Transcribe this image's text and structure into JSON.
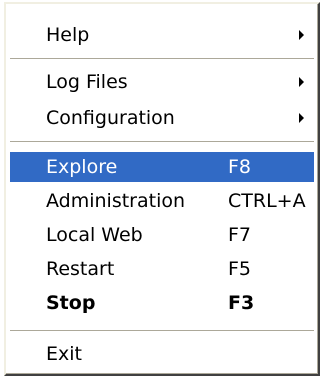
{
  "menu": {
    "items": [
      {
        "label": "Help",
        "submenu": true
      },
      {
        "label": "Log Files",
        "submenu": true
      },
      {
        "label": "Configuration",
        "submenu": true
      },
      {
        "label": "Explore",
        "shortcut": "F8",
        "selected": true
      },
      {
        "label": "Administration",
        "shortcut": "CTRL+A"
      },
      {
        "label": "Local Web",
        "shortcut": "F7"
      },
      {
        "label": "Restart",
        "shortcut": "F5"
      },
      {
        "label": "Stop",
        "shortcut": "F3",
        "bold": true
      },
      {
        "label": "Exit"
      }
    ]
  },
  "colors": {
    "highlight": "#316ac5",
    "highlight_text": "#ffffff",
    "separator": "#aca899"
  },
  "icons": {
    "submenu_arrow": "chevron-right-icon"
  }
}
